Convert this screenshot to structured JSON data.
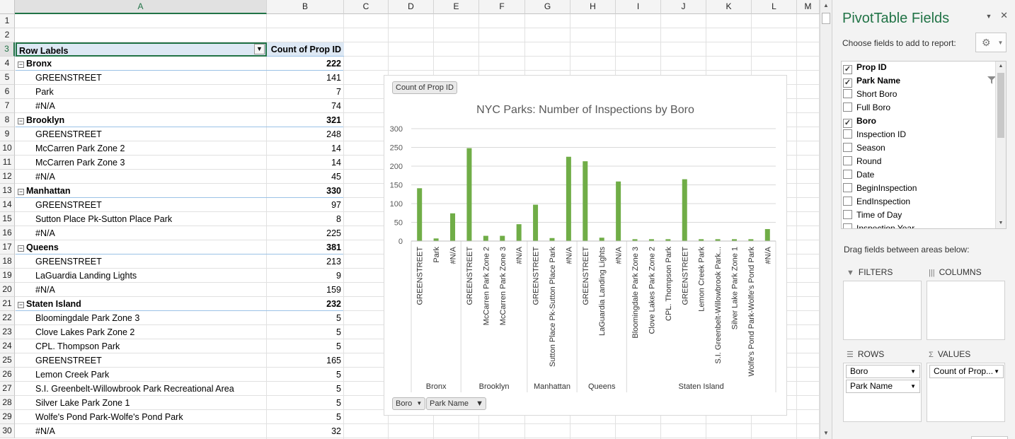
{
  "columns": [
    "A",
    "B",
    "C",
    "D",
    "E",
    "F",
    "G",
    "H",
    "I",
    "J",
    "K",
    "L",
    "M"
  ],
  "rows": [
    "1",
    "2",
    "3",
    "4",
    "5",
    "6",
    "7",
    "8",
    "9",
    "10",
    "11",
    "12",
    "13",
    "14",
    "15",
    "16",
    "17",
    "18",
    "19",
    "20",
    "21",
    "22",
    "23",
    "24",
    "25",
    "26",
    "27",
    "28",
    "29",
    "30"
  ],
  "pivot": {
    "header_label": "Row Labels",
    "header_value": "Count of Prop ID",
    "lines": [
      {
        "type": "group",
        "label": "Bronx",
        "value": "222"
      },
      {
        "type": "item",
        "label": "GREENSTREET",
        "value": "141"
      },
      {
        "type": "item",
        "label": "Park",
        "value": "7"
      },
      {
        "type": "item",
        "label": "#N/A",
        "value": "74"
      },
      {
        "type": "group",
        "label": "Brooklyn",
        "value": "321"
      },
      {
        "type": "item",
        "label": "GREENSTREET",
        "value": "248"
      },
      {
        "type": "item",
        "label": "McCarren Park Zone 2",
        "value": "14"
      },
      {
        "type": "item",
        "label": "McCarren Park Zone 3",
        "value": "14"
      },
      {
        "type": "item",
        "label": "#N/A",
        "value": "45"
      },
      {
        "type": "group",
        "label": "Manhattan",
        "value": "330"
      },
      {
        "type": "item",
        "label": "GREENSTREET",
        "value": "97"
      },
      {
        "type": "item",
        "label": "Sutton Place Pk-Sutton Place Park",
        "value": "8"
      },
      {
        "type": "item",
        "label": "#N/A",
        "value": "225"
      },
      {
        "type": "group",
        "label": "Queens",
        "value": "381"
      },
      {
        "type": "item",
        "label": "GREENSTREET",
        "value": "213"
      },
      {
        "type": "item",
        "label": "LaGuardia Landing Lights",
        "value": "9"
      },
      {
        "type": "item",
        "label": "#N/A",
        "value": "159"
      },
      {
        "type": "group",
        "label": "Staten Island",
        "value": "232"
      },
      {
        "type": "item",
        "label": "Bloomingdale Park Zone 3",
        "value": "5"
      },
      {
        "type": "item",
        "label": "Clove Lakes Park Zone 2",
        "value": "5"
      },
      {
        "type": "item",
        "label": "CPL. Thompson Park",
        "value": "5"
      },
      {
        "type": "item",
        "label": "GREENSTREET",
        "value": "165"
      },
      {
        "type": "item",
        "label": "Lemon Creek Park",
        "value": "5"
      },
      {
        "type": "item",
        "label": "S.I. Greenbelt-Willowbrook Park Recreational Area",
        "value": "5"
      },
      {
        "type": "item",
        "label": "Silver Lake Park Zone 1",
        "value": "5"
      },
      {
        "type": "item",
        "label": "Wolfe's Pond Park-Wolfe's Pond Park",
        "value": "5"
      },
      {
        "type": "item",
        "label": "#N/A",
        "value": "32"
      }
    ]
  },
  "chart_buttons": {
    "value_field": "Count of Prop ID",
    "axis_field_1": "Boro",
    "axis_field_2": "Park Name"
  },
  "chart_data": {
    "type": "bar",
    "title": "NYC Parks: Number of Inspections by Boro",
    "xlabel": "",
    "ylabel": "",
    "ylim": [
      0,
      300
    ],
    "yticks": [
      0,
      50,
      100,
      150,
      200,
      250,
      300
    ],
    "color": "#70ad47",
    "groups": [
      {
        "name": "Bronx",
        "categories": [
          "GREENSTREET",
          "Park",
          "#N/A"
        ],
        "values": [
          141,
          7,
          74
        ]
      },
      {
        "name": "Brooklyn",
        "categories": [
          "GREENSTREET",
          "McCarren Park Zone 2",
          "McCarren Park Zone 3",
          "#N/A"
        ],
        "values": [
          248,
          14,
          14,
          45
        ]
      },
      {
        "name": "Manhattan",
        "categories": [
          "GREENSTREET",
          "Sutton Place Pk-Sutton Place Park",
          "#N/A"
        ],
        "values": [
          97,
          8,
          225
        ]
      },
      {
        "name": "Queens",
        "categories": [
          "GREENSTREET",
          "LaGuardia Landing Lights",
          "#N/A"
        ],
        "values": [
          213,
          9,
          159
        ]
      },
      {
        "name": "Staten Island",
        "categories": [
          "Bloomingdale Park Zone 3",
          "Clove Lakes Park Zone 2",
          "CPL. Thompson Park",
          "GREENSTREET",
          "Lemon Creek Park",
          "S.I. Greenbelt-Willowbrook Park...",
          "Silver Lake Park Zone 1",
          "Wolfe's Pond Park-Wolfe's Pond Park",
          "#N/A"
        ],
        "values": [
          5,
          5,
          5,
          165,
          5,
          5,
          5,
          5,
          32
        ]
      }
    ],
    "grid": true,
    "legend": "none"
  },
  "pane": {
    "title": "PivotTable Fields",
    "subtitle": "Choose fields to add to report:",
    "fields": [
      {
        "label": "Prop ID",
        "checked": true
      },
      {
        "label": "Park Name",
        "checked": true
      },
      {
        "label": "Short Boro",
        "checked": false
      },
      {
        "label": "Full Boro",
        "checked": false
      },
      {
        "label": "Boro",
        "checked": true
      },
      {
        "label": "Inspection ID",
        "checked": false
      },
      {
        "label": "Season",
        "checked": false
      },
      {
        "label": "Round",
        "checked": false
      },
      {
        "label": "Date",
        "checked": false
      },
      {
        "label": "BeginInspection",
        "checked": false
      },
      {
        "label": "EndInspection",
        "checked": false
      },
      {
        "label": "Time of Day",
        "checked": false
      },
      {
        "label": "Inspection Year",
        "checked": false
      }
    ],
    "drag_note": "Drag fields between areas below:",
    "filters_label": "FILTERS",
    "columns_label": "COLUMNS",
    "rows_label": "ROWS",
    "values_label": "VALUES",
    "rows_items": [
      "Boro",
      "Park Name"
    ],
    "values_items": [
      "Count of Prop..."
    ],
    "icons": {
      "settings": "gear-icon",
      "close": "close-icon",
      "filter": "funnel-icon"
    }
  }
}
